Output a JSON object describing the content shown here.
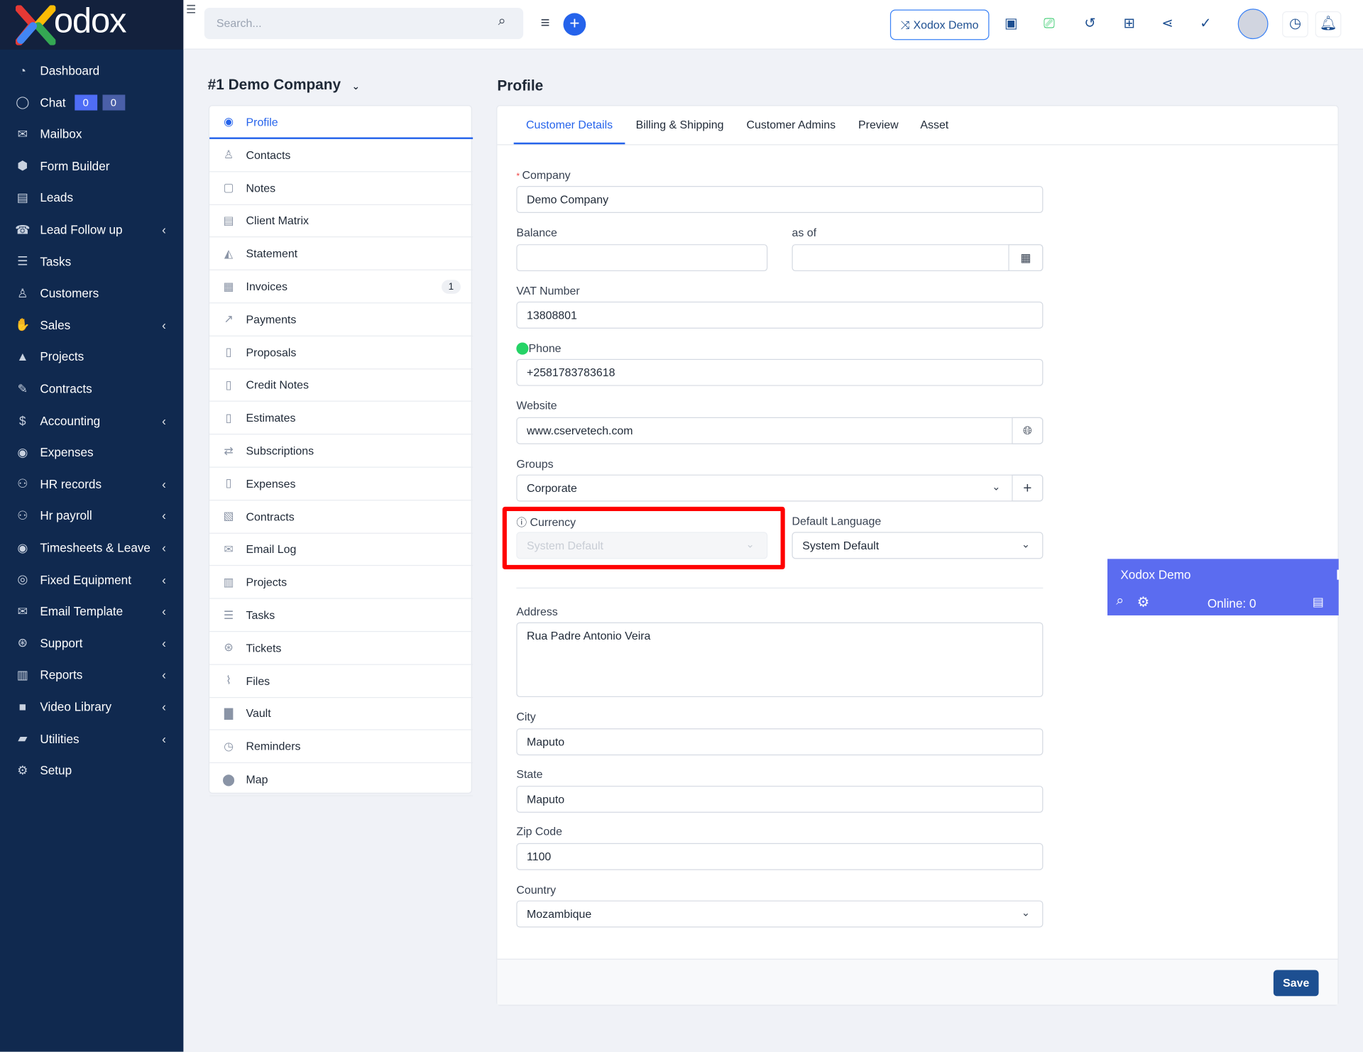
{
  "brand": {
    "logo_text": "odox"
  },
  "sidebar": {
    "items": [
      {
        "label": "Dashboard",
        "icon": "gauge-icon",
        "chevron": false
      },
      {
        "label": "Chat",
        "icon": "chat-icon",
        "chevron": false,
        "badges": [
          "0",
          "0"
        ]
      },
      {
        "label": "Mailbox",
        "icon": "envelope-icon",
        "chevron": false
      },
      {
        "label": "Form Builder",
        "icon": "cubes-icon",
        "chevron": false
      },
      {
        "label": "Leads",
        "icon": "leads-icon",
        "chevron": false
      },
      {
        "label": "Lead Follow up",
        "icon": "fax-icon",
        "chevron": true
      },
      {
        "label": "Tasks",
        "icon": "tasks-icon",
        "chevron": false
      },
      {
        "label": "Customers",
        "icon": "user-icon",
        "chevron": false
      },
      {
        "label": "Sales",
        "icon": "hand-coin-icon",
        "chevron": true
      },
      {
        "label": "Projects",
        "icon": "projects-icon",
        "chevron": false
      },
      {
        "label": "Contracts",
        "icon": "signature-icon",
        "chevron": false
      },
      {
        "label": "Accounting",
        "icon": "dollar-icon",
        "chevron": true
      },
      {
        "label": "Expenses",
        "icon": "money-bag-icon",
        "chevron": false
      },
      {
        "label": "HR records",
        "icon": "users-icon",
        "chevron": true
      },
      {
        "label": "Hr payroll",
        "icon": "users-icon",
        "chevron": true
      },
      {
        "label": "Timesheets & Leave",
        "icon": "user-circle-icon",
        "chevron": true
      },
      {
        "label": "Fixed Equipment",
        "icon": "target-icon",
        "chevron": true
      },
      {
        "label": "Email Template",
        "icon": "envelope-icon",
        "chevron": true
      },
      {
        "label": "Support",
        "icon": "life-ring-icon",
        "chevron": true
      },
      {
        "label": "Reports",
        "icon": "bar-chart-icon",
        "chevron": true
      },
      {
        "label": "Video Library",
        "icon": "video-icon",
        "chevron": true
      },
      {
        "label": "Utilities",
        "icon": "toolbox-icon",
        "chevron": true
      },
      {
        "label": "Setup",
        "icon": "gear-icon",
        "chevron": false
      }
    ]
  },
  "topbar": {
    "search_placeholder": "Search...",
    "demo_label": "Xodox Demo"
  },
  "customer": {
    "title": "#1 Demo Company",
    "menu": [
      {
        "label": "Profile",
        "icon": "user-circle-icon",
        "active": true
      },
      {
        "label": "Contacts",
        "icon": "user-icon"
      },
      {
        "label": "Notes",
        "icon": "note-icon"
      },
      {
        "label": "Client Matrix",
        "icon": "clipboard-icon"
      },
      {
        "label": "Statement",
        "icon": "area-chart-icon"
      },
      {
        "label": "Invoices",
        "icon": "invoice-icon",
        "count": "1"
      },
      {
        "label": "Payments",
        "icon": "line-chart-icon"
      },
      {
        "label": "Proposals",
        "icon": "file-icon"
      },
      {
        "label": "Credit Notes",
        "icon": "file-icon"
      },
      {
        "label": "Estimates",
        "icon": "file-icon"
      },
      {
        "label": "Subscriptions",
        "icon": "repeat-icon"
      },
      {
        "label": "Expenses",
        "icon": "file-icon"
      },
      {
        "label": "Contracts",
        "icon": "contract-icon"
      },
      {
        "label": "Email Log",
        "icon": "envelope-icon"
      },
      {
        "label": "Projects",
        "icon": "bar-chart-icon"
      },
      {
        "label": "Tasks",
        "icon": "tasks-icon"
      },
      {
        "label": "Tickets",
        "icon": "life-ring-icon"
      },
      {
        "label": "Files",
        "icon": "paperclip-icon"
      },
      {
        "label": "Vault",
        "icon": "lock-icon"
      },
      {
        "label": "Reminders",
        "icon": "clock-icon"
      },
      {
        "label": "Map",
        "icon": "map-pin-icon"
      }
    ]
  },
  "profile": {
    "title": "Profile",
    "tabs": [
      "Customer Details",
      "Billing & Shipping",
      "Customer Admins",
      "Preview",
      "Asset"
    ],
    "active_tab": 0,
    "form": {
      "company_label": "Company",
      "company": "Demo Company",
      "balance_label": "Balance",
      "balance": "",
      "asof_label": "as of",
      "asof": "",
      "vat_label": "VAT Number",
      "vat": "13808801",
      "phone_label": "Phone",
      "phone": "+2581783783618",
      "website_label": "Website",
      "website": "www.cservetech.com",
      "groups_label": "Groups",
      "groups": "Corporate",
      "currency_label": "Currency",
      "currency": "System Default",
      "language_label": "Default Language",
      "language": "System Default",
      "address_label": "Address",
      "address": "Rua Padre  Antonio Veira",
      "city_label": "City",
      "city": "Maputo",
      "state_label": "State",
      "state": "Maputo",
      "zip_label": "Zip Code",
      "zip": "1100",
      "country_label": "Country",
      "country": "Mozambique"
    },
    "save_label": "Save"
  },
  "chat_widget": {
    "title": "Xodox Demo",
    "online": "Online: 0"
  },
  "colors": {
    "sidebar": "#10294f",
    "accent": "#2563eb",
    "save": "#1d4f91",
    "highlight": "#ff0000",
    "widget": "#5b6cf0"
  }
}
